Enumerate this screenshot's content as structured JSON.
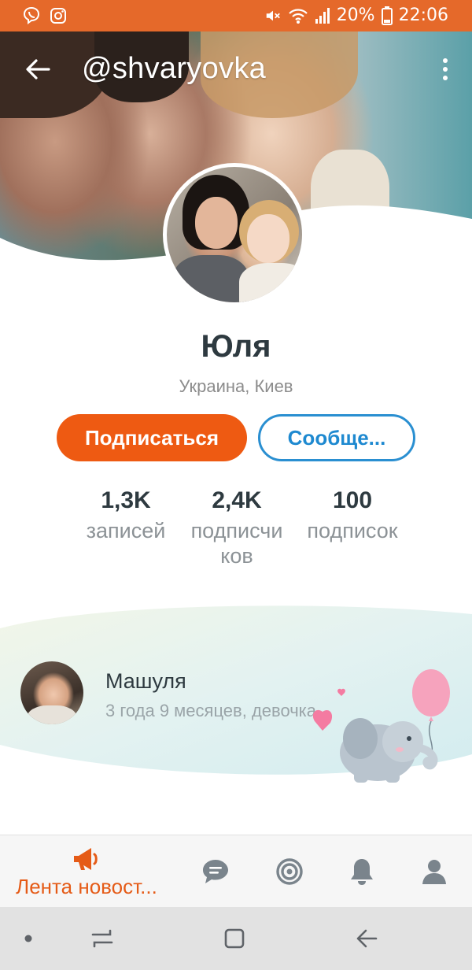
{
  "status_bar": {
    "battery": "20%",
    "time": "22:06"
  },
  "header": {
    "username": "@shvaryovka"
  },
  "profile": {
    "name": "Юля",
    "location": "Украина, Киев",
    "subscribe_label": "Подписаться",
    "message_label": "Сообще..."
  },
  "stats": [
    {
      "value": "1,3K",
      "label": "записей"
    },
    {
      "value": "2,4K",
      "label": "подписчи ков"
    },
    {
      "value": "100",
      "label": "подписок"
    }
  ],
  "child": {
    "name": "Машуля",
    "info": "3 года 9 месяцев, девочка"
  },
  "bottom_nav": {
    "feed_label": "Лента новост..."
  },
  "colors": {
    "accent_orange": "#ee5a12",
    "status_bar": "#e5692a",
    "link_blue": "#1e89d0"
  }
}
